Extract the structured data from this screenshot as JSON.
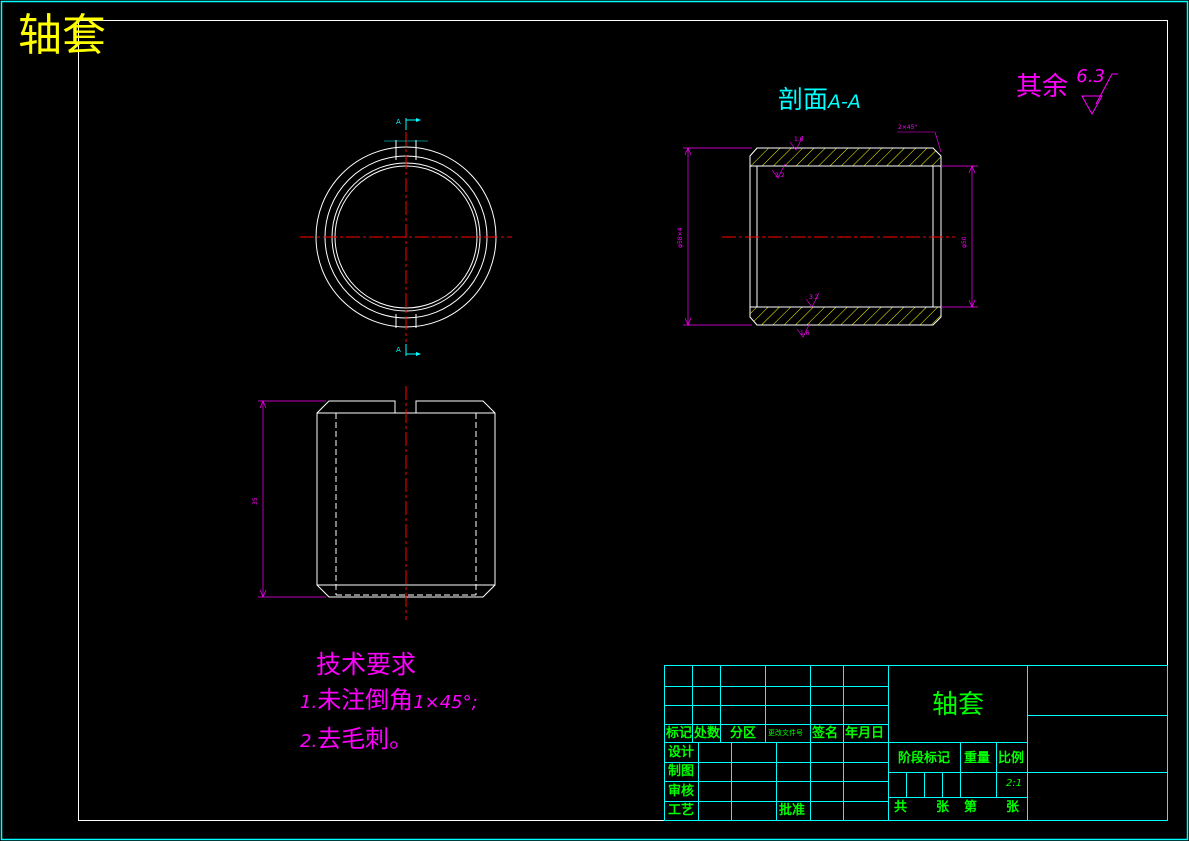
{
  "drawing": {
    "title": "轴套",
    "section_label": "剖面",
    "section_suffix": "A-A",
    "roughness_label": "其余",
    "roughness_value": "6.3",
    "section_marker_top": "A",
    "section_marker_bottom": "A",
    "dims": {
      "left_height": "35",
      "sec_left_dia": "φ58×4",
      "sec_right_dia": "φ50",
      "chamfer": "2×45°",
      "r1": "1.6",
      "r2": "3.2",
      "r3": "3.2",
      "r4": "1.6"
    }
  },
  "tech": {
    "heading": "技术要求",
    "item1_num": "1.",
    "item1_text": "未注倒角",
    "item1_value": "1×45°;",
    "item2_num": "2.",
    "item2_text": "去毛刺。"
  },
  "title_block": {
    "part_name": "轴套",
    "hdr_mark": "标记",
    "hdr_count": "处数",
    "hdr_zone": "分区",
    "hdr_doc": "更改文件号",
    "hdr_sign": "签名",
    "hdr_date": "年月日",
    "design": "设计",
    "draw": "制图",
    "review": "审核",
    "process": "工艺",
    "approve": "批准",
    "stage": "阶段标记",
    "weight": "重量",
    "ratio": "比例",
    "scale": "2:1",
    "total": "共",
    "sheets": "张",
    "sheet_no": "第",
    "sheets2": "张"
  },
  "colors": {
    "frame": "#00ffff",
    "outline": "#ffffff",
    "center": "#ff0000",
    "dimension": "#ff00ff",
    "hatch": "#ffff00",
    "title_block": "#00ffff",
    "title_text": "#00ff00"
  }
}
